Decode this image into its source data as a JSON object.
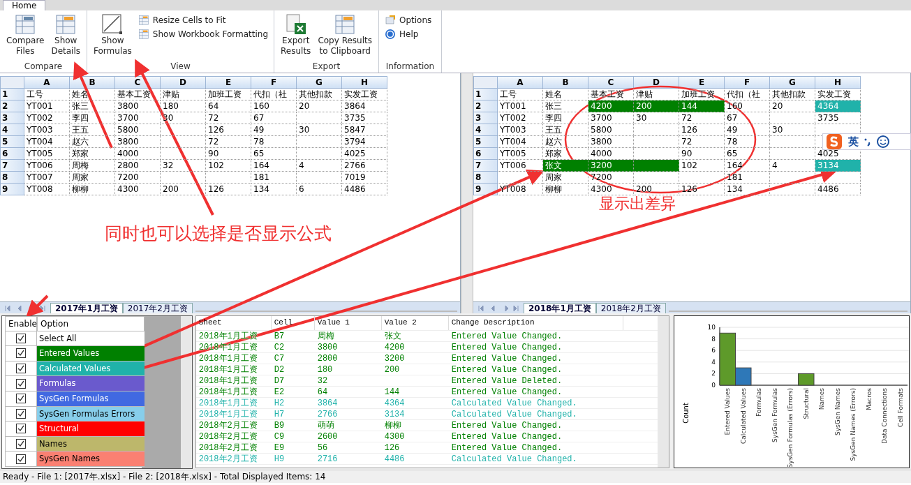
{
  "ribbon": {
    "tabs": [
      {
        "label": "Home",
        "selected": true
      }
    ],
    "groups": [
      {
        "title": "Compare",
        "buttons": [
          {
            "kind": "large",
            "label": "Compare\nFiles"
          },
          {
            "kind": "large",
            "label": "Show\nDetails"
          }
        ]
      },
      {
        "title": "View",
        "buttons": [
          {
            "kind": "large",
            "label": "Show\nFormulas"
          },
          {
            "kind": "small",
            "label": "Resize Cells to Fit"
          },
          {
            "kind": "small",
            "label": "Show Workbook Formatting"
          }
        ]
      },
      {
        "title": "Export",
        "buttons": [
          {
            "kind": "large",
            "label": "Export\nResults"
          },
          {
            "kind": "large",
            "label": "Copy Results\nto Clipboard"
          }
        ]
      },
      {
        "title": "Information",
        "buttons": [
          {
            "kind": "small",
            "label": "Options"
          },
          {
            "kind": "small",
            "label": "Help"
          }
        ]
      }
    ]
  },
  "left_grid": {
    "columns": [
      "A",
      "B",
      "C",
      "D",
      "E",
      "F",
      "G",
      "H"
    ],
    "row_numbers": [
      "1",
      "2",
      "3",
      "4",
      "5",
      "6",
      "7",
      "8",
      "9"
    ],
    "rows": [
      [
        "工号",
        "姓名",
        "基本工资",
        "津贴",
        "加班工资",
        "代扣（社",
        "其他扣款",
        "实发工资"
      ],
      [
        "YT001",
        "张三",
        "3800",
        "180",
        "64",
        "160",
        "20",
        "3864"
      ],
      [
        "YT002",
        "李四",
        "3700",
        "30",
        "72",
        "67",
        "",
        "3735"
      ],
      [
        "YT003",
        "王五",
        "5800",
        "",
        "126",
        "49",
        "30",
        "5847"
      ],
      [
        "YT004",
        "赵六",
        "3800",
        "",
        "72",
        "78",
        "",
        "3794"
      ],
      [
        "YT005",
        "郑家",
        "4000",
        "",
        "90",
        "65",
        "",
        "4025"
      ],
      [
        "YT006",
        "周梅",
        "2800",
        "32",
        "102",
        "164",
        "4",
        "2766"
      ],
      [
        "YT007",
        "周家",
        "7200",
        "",
        "",
        "181",
        "",
        "7019"
      ],
      [
        "YT008",
        "柳柳",
        "4300",
        "200",
        "126",
        "134",
        "6",
        "4486"
      ]
    ],
    "sheet_tabs": [
      {
        "label": "2017年1月工资",
        "selected": true
      },
      {
        "label": "2017年2月工资",
        "selected": false
      }
    ]
  },
  "right_grid": {
    "columns": [
      "A",
      "B",
      "C",
      "D",
      "E",
      "F",
      "G",
      "H"
    ],
    "row_numbers": [
      "1",
      "2",
      "3",
      "4",
      "5",
      "6",
      "7",
      "8",
      "9"
    ],
    "rows": [
      [
        "工号",
        "姓名",
        "基本工资",
        "津贴",
        "加班工资",
        "代扣（社",
        "其他扣款",
        "实发工资"
      ],
      [
        "YT001",
        "张三",
        {
          "text": "4200",
          "color": "#008000"
        },
        {
          "text": "200",
          "color": "#008000"
        },
        {
          "text": "144",
          "color": "#008000"
        },
        "160",
        "20",
        {
          "text": "4364",
          "color": "#20b2aa"
        }
      ],
      [
        "YT002",
        "李四",
        "3700",
        "30",
        "72",
        "67",
        "",
        "3735"
      ],
      [
        "YT003",
        "王五",
        "5800",
        "",
        "126",
        "49",
        "30",
        ""
      ],
      [
        "YT004",
        "赵六",
        "3800",
        "",
        "72",
        "78",
        "",
        ""
      ],
      [
        "YT005",
        "郑家",
        "4000",
        "",
        "90",
        "65",
        "",
        "4025"
      ],
      [
        "YT006",
        {
          "text": "张文",
          "color": "#008000"
        },
        {
          "text": "3200",
          "color": "#008000"
        },
        {
          "text": "",
          "color": "#008000"
        },
        "102",
        "164",
        "4",
        {
          "text": "3134",
          "color": "#20b2aa"
        }
      ],
      [
        "",
        "周家",
        "7200",
        "",
        "",
        "181",
        "",
        ""
      ],
      [
        "YT008",
        "柳柳",
        "4300",
        "200",
        "126",
        "134",
        "",
        "4486"
      ]
    ],
    "sheet_tabs": [
      {
        "label": "2018年1月工资",
        "selected": true
      },
      {
        "label": "2018年2月工资",
        "selected": false
      }
    ]
  },
  "ime": {
    "mode_label": "英"
  },
  "options": {
    "columns": [
      "Enable",
      "Option"
    ],
    "items": [
      {
        "label": "Select All",
        "checked": true,
        "color": "#ffffff"
      },
      {
        "label": "Entered Values",
        "checked": true,
        "color": "#008000"
      },
      {
        "label": "Calculated Values",
        "checked": true,
        "color": "#20b2aa"
      },
      {
        "label": "Formulas",
        "checked": true,
        "color": "#6a5acd"
      },
      {
        "label": "SysGen Formulas",
        "checked": true,
        "color": "#4169e1"
      },
      {
        "label": "SysGen Formulas Errors",
        "checked": true,
        "color": "#87ceeb"
      },
      {
        "label": "Structural",
        "checked": true,
        "color": "#ff0000"
      },
      {
        "label": "Names",
        "checked": true,
        "color": "#bdb76b"
      },
      {
        "label": "SysGen Names",
        "checked": true,
        "color": "#fa8072"
      }
    ]
  },
  "changes": {
    "columns": [
      "Sheet",
      "Cell",
      "Value 1",
      "Value 2",
      "Change Description"
    ],
    "rows": [
      {
        "kind": "entered",
        "cells": [
          "2018年1月工资",
          "B7",
          "周梅",
          "张文",
          "Entered Value Changed."
        ]
      },
      {
        "kind": "entered",
        "cells": [
          "2018年1月工资",
          "C2",
          "3800",
          "4200",
          "Entered Value Changed."
        ]
      },
      {
        "kind": "entered",
        "cells": [
          "2018年1月工资",
          "C7",
          "2800",
          "3200",
          "Entered Value Changed."
        ]
      },
      {
        "kind": "entered",
        "cells": [
          "2018年1月工资",
          "D2",
          "180",
          "200",
          "Entered Value Changed."
        ]
      },
      {
        "kind": "entered",
        "cells": [
          "2018年1月工资",
          "D7",
          "32",
          "",
          "Entered Value Deleted."
        ]
      },
      {
        "kind": "entered",
        "cells": [
          "2018年1月工资",
          "E2",
          "64",
          "144",
          "Entered Value Changed."
        ]
      },
      {
        "kind": "calculated",
        "cells": [
          "2018年1月工资",
          "H2",
          "3864",
          "4364",
          "Calculated Value Changed."
        ]
      },
      {
        "kind": "calculated",
        "cells": [
          "2018年1月工资",
          "H7",
          "2766",
          "3134",
          "Calculated Value Changed."
        ]
      },
      {
        "kind": "entered",
        "cells": [
          "2018年2月工资",
          "B9",
          "萌萌",
          "柳柳",
          "Entered Value Changed."
        ]
      },
      {
        "kind": "entered",
        "cells": [
          "2018年2月工资",
          "C9",
          "2600",
          "4300",
          "Entered Value Changed."
        ]
      },
      {
        "kind": "entered",
        "cells": [
          "2018年2月工资",
          "E9",
          "56",
          "126",
          "Entered Value Changed."
        ]
      },
      {
        "kind": "calculated",
        "cells": [
          "2018年2月工资",
          "H9",
          "2716",
          "4486",
          "Calculated Value Changed."
        ]
      }
    ]
  },
  "summary_chart": {
    "chart_data": {
      "type": "bar",
      "ylabel": "Count",
      "categories": [
        "Entered Values",
        "Calculated Values",
        "Formulas",
        "SysGen Formulas",
        "SysGen Formulas (Errors)",
        "Structural",
        "Names",
        "SysGen Names",
        "SysGen Names (Errors)",
        "Macros",
        "Data Connections",
        "Cell Formats"
      ],
      "series": [
        {
          "color": "#5e9a2a",
          "values": [
            9,
            null,
            null,
            null,
            null,
            2,
            null,
            null,
            null,
            null,
            null,
            null
          ]
        },
        {
          "color": "#2e78b8",
          "values": [
            null,
            3,
            null,
            null,
            null,
            null,
            null,
            null,
            null,
            null,
            null,
            null
          ]
        }
      ],
      "ylim": [
        0,
        10
      ],
      "yticks": [
        0,
        2,
        4,
        6,
        8,
        10
      ],
      "stacked": true,
      "grid": true
    }
  },
  "annotations": [
    {
      "text": "同时也可以选择是否显示公式"
    },
    {
      "text": "显示出差异"
    }
  ],
  "status_bar": "Ready - File 1: [2017年.xlsx] - File 2: [2018年.xlsx] - Total Displayed Items: 14"
}
